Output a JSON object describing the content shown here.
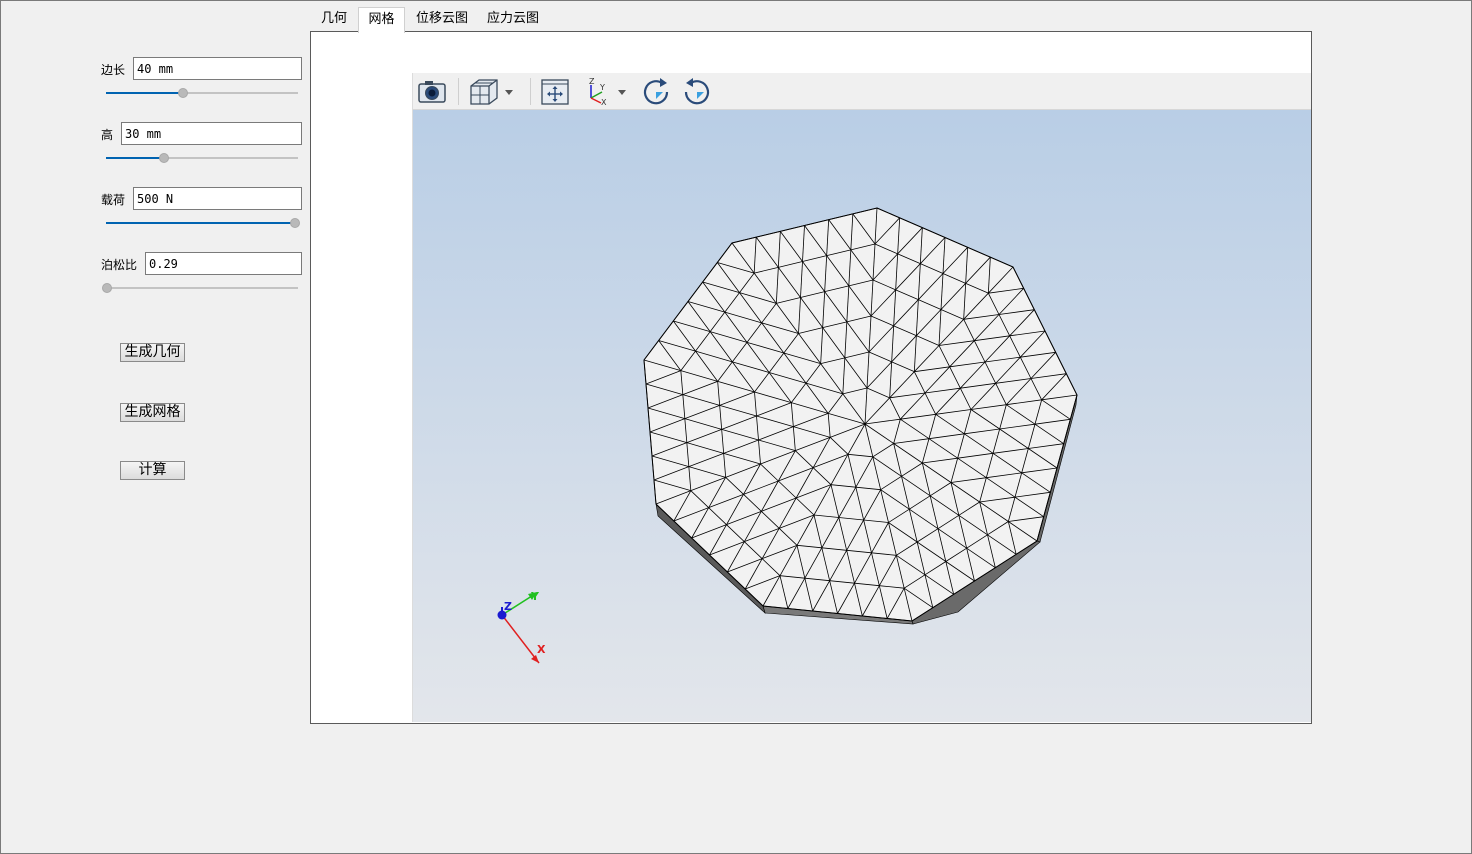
{
  "params": [
    {
      "label": "边长",
      "value": "40 mm"
    },
    {
      "label": "高",
      "value": "30 mm"
    },
    {
      "label": "载荷",
      "value": "500 N"
    },
    {
      "label": "泊松比",
      "value": "0.29"
    }
  ],
  "sliders": [
    {
      "fraction": 0.4
    },
    {
      "fraction": 0.3
    },
    {
      "fraction": 1.0
    },
    {
      "fraction": 0.0
    }
  ],
  "buttons": {
    "generate_geometry": "生成几何",
    "generate_mesh": "生成网格",
    "compute": "计算"
  },
  "tabs": [
    {
      "label": "几何"
    },
    {
      "label": "网格",
      "active": true
    },
    {
      "label": "位移云图"
    },
    {
      "label": "应力云图"
    }
  ],
  "toolbar": [
    {
      "icon": "camera-icon"
    },
    {
      "icon": "view-cube-icon"
    },
    {
      "icon": "fit-all-icon"
    },
    {
      "icon": "axes-view-icon"
    },
    {
      "icon": "rotate-clockwise-icon"
    },
    {
      "icon": "rotate-counterclockwise-icon"
    }
  ],
  "triad": {
    "x": "X",
    "y": "Y",
    "z": "Z"
  },
  "toolbar_axes_labels": {
    "x": "X",
    "y": "Y",
    "z": "Z"
  },
  "colors": {
    "slider_fill": "#0063b1",
    "axis_x": "#e02020",
    "axis_y": "#20c020",
    "axis_z": "#1a1ad0",
    "mesh_face": "#f2f2f2",
    "mesh_side": "#555555"
  }
}
